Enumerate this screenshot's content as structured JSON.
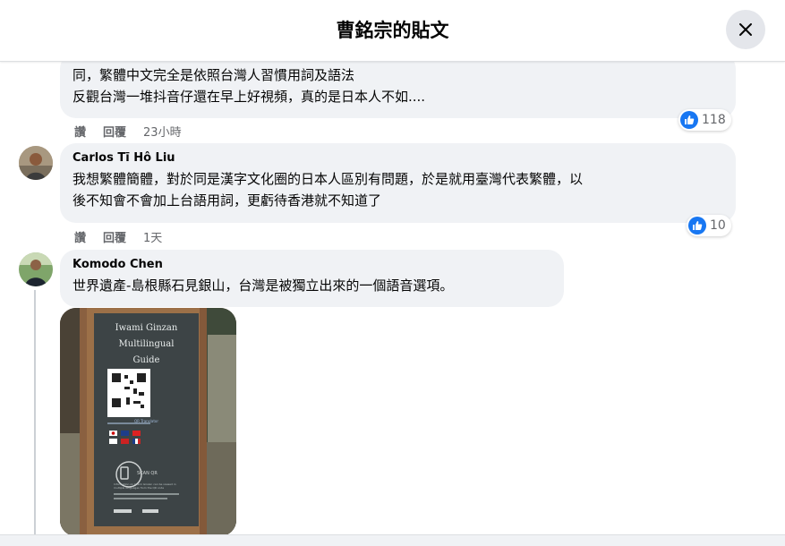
{
  "header": {
    "title": "曹銘宗的貼文"
  },
  "comments": [
    {
      "lines": [
        "同，繁體中文完全是依照台灣人習慣用詞及語法",
        "反觀台灣一堆抖音仔還在早上好視頻，真的是日本人不如...."
      ],
      "like_label": "讚",
      "reply_label": "回覆",
      "time": "23小時",
      "reactions": "118"
    },
    {
      "author": "Carlos Tī Hô Liu",
      "lines": [
        "我想繁體簡體，對於同是漢字文化圈的日本人區別有問題，於是就用臺灣代表繁體，以",
        "後不知會不會加上台語用詞，更虧待香港就不知道了"
      ],
      "like_label": "讚",
      "reply_label": "回覆",
      "time": "1天",
      "reactions": "10"
    },
    {
      "author": "Komodo Chen",
      "lines": [
        "世界遺產-島根縣石見銀山，台灣是被獨立出來的一個語音選項。"
      ]
    }
  ],
  "photo_sign": {
    "title_lines": [
      "Iwami Ginzan",
      "Multilingual",
      "Guide"
    ],
    "qr_caption": "QR Translator",
    "scan_label": "SCAN QR",
    "footer_text": "Information on Iwami Ginzan can be viewed in multiple languages from the QR code"
  },
  "colors": {
    "accent": "#1877f2",
    "bubble": "#f0f2f5",
    "text": "#050505",
    "meta": "#65676b"
  }
}
